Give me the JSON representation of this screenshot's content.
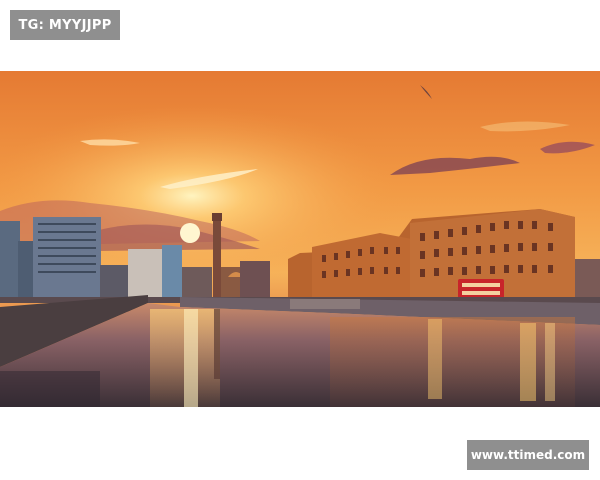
{
  "watermarks": {
    "top_left": "TG: MYYJJPP",
    "bottom_right": "www.ttimed.com"
  },
  "photo": {
    "subject": "sunset-over-dock-waterfront",
    "colors": {
      "sky_top": "#e8843a",
      "sky_mid": "#f3a24a",
      "sun": "#fff1b0",
      "water_dark": "#3a2f36",
      "brick": "#b8642e"
    }
  }
}
